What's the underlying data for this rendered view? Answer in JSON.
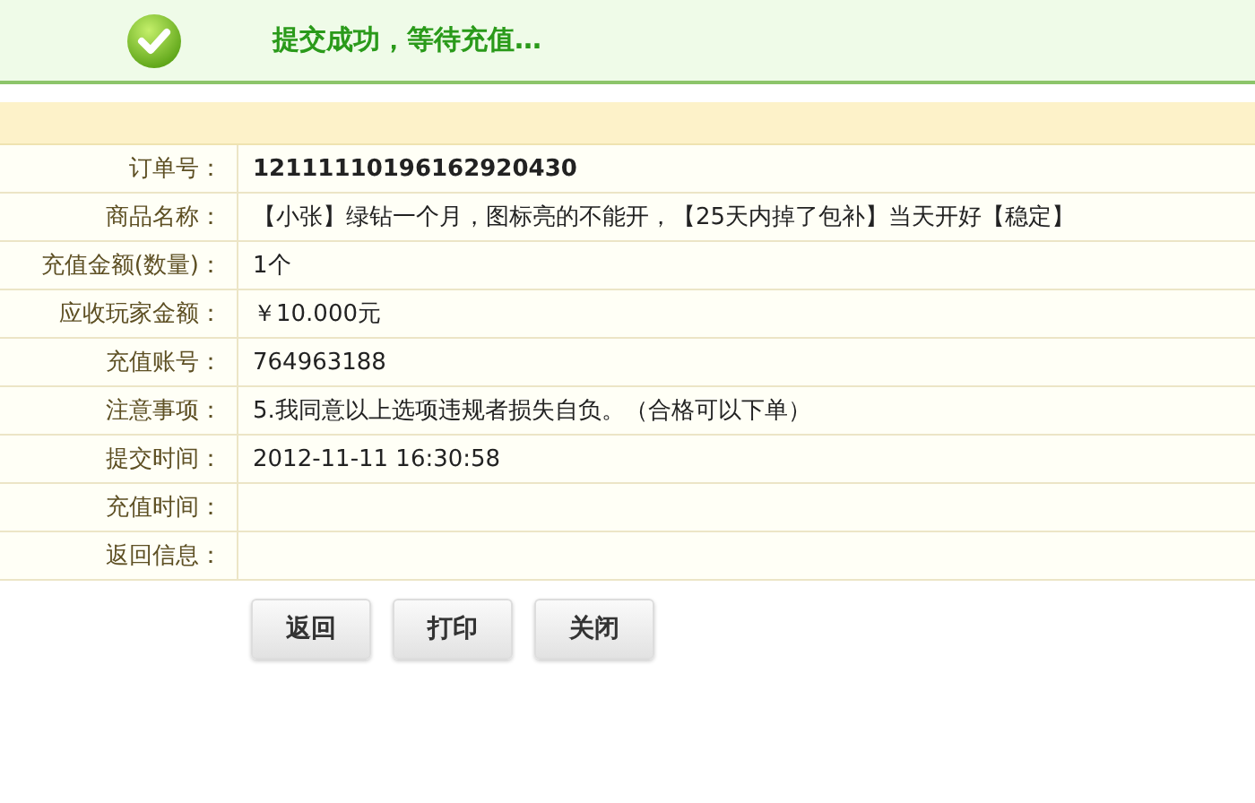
{
  "banner": {
    "message": "提交成功，等待充值…"
  },
  "order_details": [
    {
      "label": "订单号：",
      "value": "12111110196162920430",
      "kind": "bold"
    },
    {
      "label": "商品名称：",
      "value": "【小张】绿钻一个月，图标亮的不能开，【25天内掉了包补】当天开好【稳定】",
      "kind": "plain"
    },
    {
      "label": "充值金额(数量)：",
      "value": "1个",
      "kind": "plain"
    },
    {
      "label": "应收玩家金额：",
      "value": "￥10.000元",
      "kind": "plain"
    },
    {
      "label": "充值账号：",
      "value": "764963188",
      "kind": "plain"
    },
    {
      "label": "注意事项：",
      "value": "5.我同意以上选项违规者损失自负。（合格可以下单）",
      "kind": "plain"
    },
    {
      "label": "提交时间：",
      "value": "2012-11-11 16:30:58",
      "kind": "plain"
    },
    {
      "label": "充值时间：",
      "kind": "plain"
    },
    {
      "label": "返回信息：",
      "kind": "plain"
    }
  ],
  "buttons": [
    "返回",
    "打印",
    "关闭"
  ]
}
